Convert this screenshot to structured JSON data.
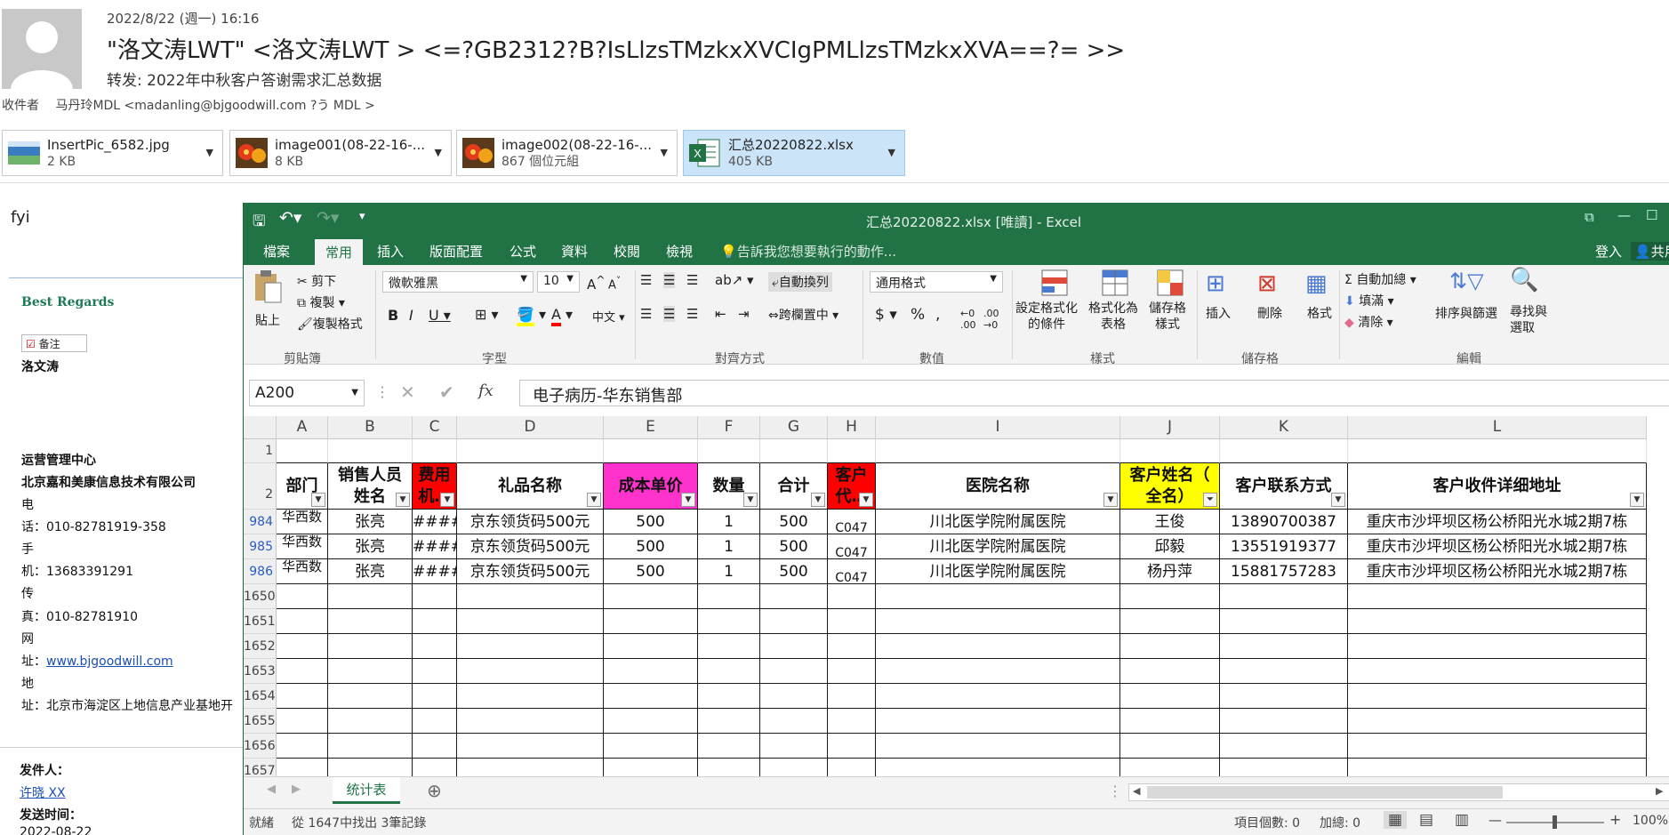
{
  "email": {
    "date": "2022/8/22 (週一) 16:16",
    "from": "\"洛文涛LWT\" <洛文涛LWT > <=?GB2312?B?IsLlzsTMzkxXVCIgPMLlzsTMzkxXVA==?= >>",
    "subject": "转发:  2022年中秋客户答谢需求汇总数据",
    "to_label": "收件者",
    "to_value": "马丹玲MDL <madanling@bjgoodwill.com ?う    MDL >"
  },
  "attachments": [
    {
      "name": "InsertPic_6582.jpg",
      "size": "2 KB",
      "icon": "jpg-thumbnail-icon"
    },
    {
      "name": "image001(08-22-16-...",
      "size": "8 KB",
      "icon": "flower-image-icon"
    },
    {
      "name": "image002(08-22-16-...",
      "size": "867 個位元組",
      "icon": "flower-image-icon"
    },
    {
      "name": "汇总20220822.xlsx",
      "size": "405 KB",
      "icon": "excel-file-icon"
    }
  ],
  "body": {
    "fyi": "fyi",
    "regards": "Best Regards",
    "note_label": "备注",
    "signer": "洛文涛",
    "dept": "运营管理中心",
    "company": "北京嘉和美康信息技术有限公司",
    "tel_a": "电",
    "tel_b": "话：010-82781919-358",
    "mob_a": "手",
    "mob_b": "机：13683391291",
    "fax_a": "传",
    "fax_b": "真：010-82781910",
    "web_a": "网",
    "web_b_label": "址：",
    "web_b_link": "www.bjgoodwill.com",
    "addr_a": "地",
    "addr_b": "址：北京市海淀区上地信息产业基地开",
    "sender_label": "发件人：",
    "sender_name": "许晓 XX",
    "sent_label": "发送时间：",
    "sent_value": "2022-08-22"
  },
  "excel": {
    "window_title": "汇总20220822.xlsx  [唯讀] - Excel",
    "tabs": [
      "檔案",
      "常用",
      "插入",
      "版面配置",
      "公式",
      "資料",
      "校閱",
      "檢視"
    ],
    "tell_me": "告訴我您想要執行的動作...",
    "login": "登入",
    "share": "共用",
    "ribbon": {
      "cut": "剪下",
      "copy": "複製",
      "format_painter": "複製格式",
      "paste": "貼上",
      "clipboard": "剪貼簿",
      "font_name": "微軟雅黑",
      "font_size": "10",
      "font_group": "字型",
      "wrap": "自動換列",
      "merge": "跨欄置中",
      "align_group": "對齊方式",
      "number_format": "通用格式",
      "number_group": "數值",
      "cond_fmt": "設定格式化\n的條件",
      "table_fmt": "格式化為\n表格",
      "cell_style": "儲存格\n樣式",
      "styles_group": "樣式",
      "insert": "插入",
      "delete": "刪除",
      "format": "格式",
      "cells_group": "儲存格",
      "autosum": "自動加總",
      "fill": "填滿",
      "clear": "清除",
      "sort": "排序與篩選",
      "find": "尋找與\n選取",
      "edit_group": "編輯"
    },
    "name_box": "A200",
    "formula": "电子病历-华东销售部",
    "columns": [
      "A",
      "B",
      "C",
      "D",
      "E",
      "F",
      "G",
      "H",
      "I",
      "J",
      "K",
      "L"
    ],
    "headers": [
      "部门",
      "销售人员\n姓名",
      "费用\n机…",
      "礼品名称",
      "成本单价",
      "数量",
      "合计",
      "客户\n代…",
      "医院名称",
      "客户姓名（\n全名）",
      "客户联系方式",
      "客户收件详细地址"
    ],
    "rows": [
      {
        "num": "1",
        "cells": []
      },
      {
        "num": "2",
        "cells": []
      },
      {
        "num": "984",
        "cells": [
          "华西数",
          "张亮",
          "####",
          "京东领货码500元",
          "500",
          "1",
          "500",
          "C047",
          "川北医学院附属医院",
          "王俊",
          "13890700387",
          "重庆市沙坪坝区杨公桥阳光水城2期7栋"
        ]
      },
      {
        "num": "985",
        "cells": [
          "华西数",
          "张亮",
          "####",
          "京东领货码500元",
          "500",
          "1",
          "500",
          "C047",
          "川北医学院附属医院",
          "邱毅",
          "13551919377",
          "重庆市沙坪坝区杨公桥阳光水城2期7栋"
        ]
      },
      {
        "num": "986",
        "cells": [
          "华西数",
          "张亮",
          "####",
          "京东领货码500元",
          "500",
          "1",
          "500",
          "C047",
          "川北医学院附属医院",
          "杨丹萍",
          "15881757283",
          "重庆市沙坪坝区杨公桥阳光水城2期7栋"
        ]
      }
    ],
    "empty_rows": [
      "1650",
      "1651",
      "1652",
      "1653",
      "1654",
      "1655",
      "1656",
      "1657"
    ],
    "sheet_tab": "统计表",
    "status_ready": "就緒",
    "status_found": "從 1647中找出 3筆記錄",
    "status_count": "項目個數: 0",
    "status_sum": "加總: 0",
    "zoom": "100%",
    "colors": {
      "green": "#217346",
      "red": "#ff0000",
      "pink": "#ff33cc",
      "yellow": "#ffff00"
    }
  }
}
